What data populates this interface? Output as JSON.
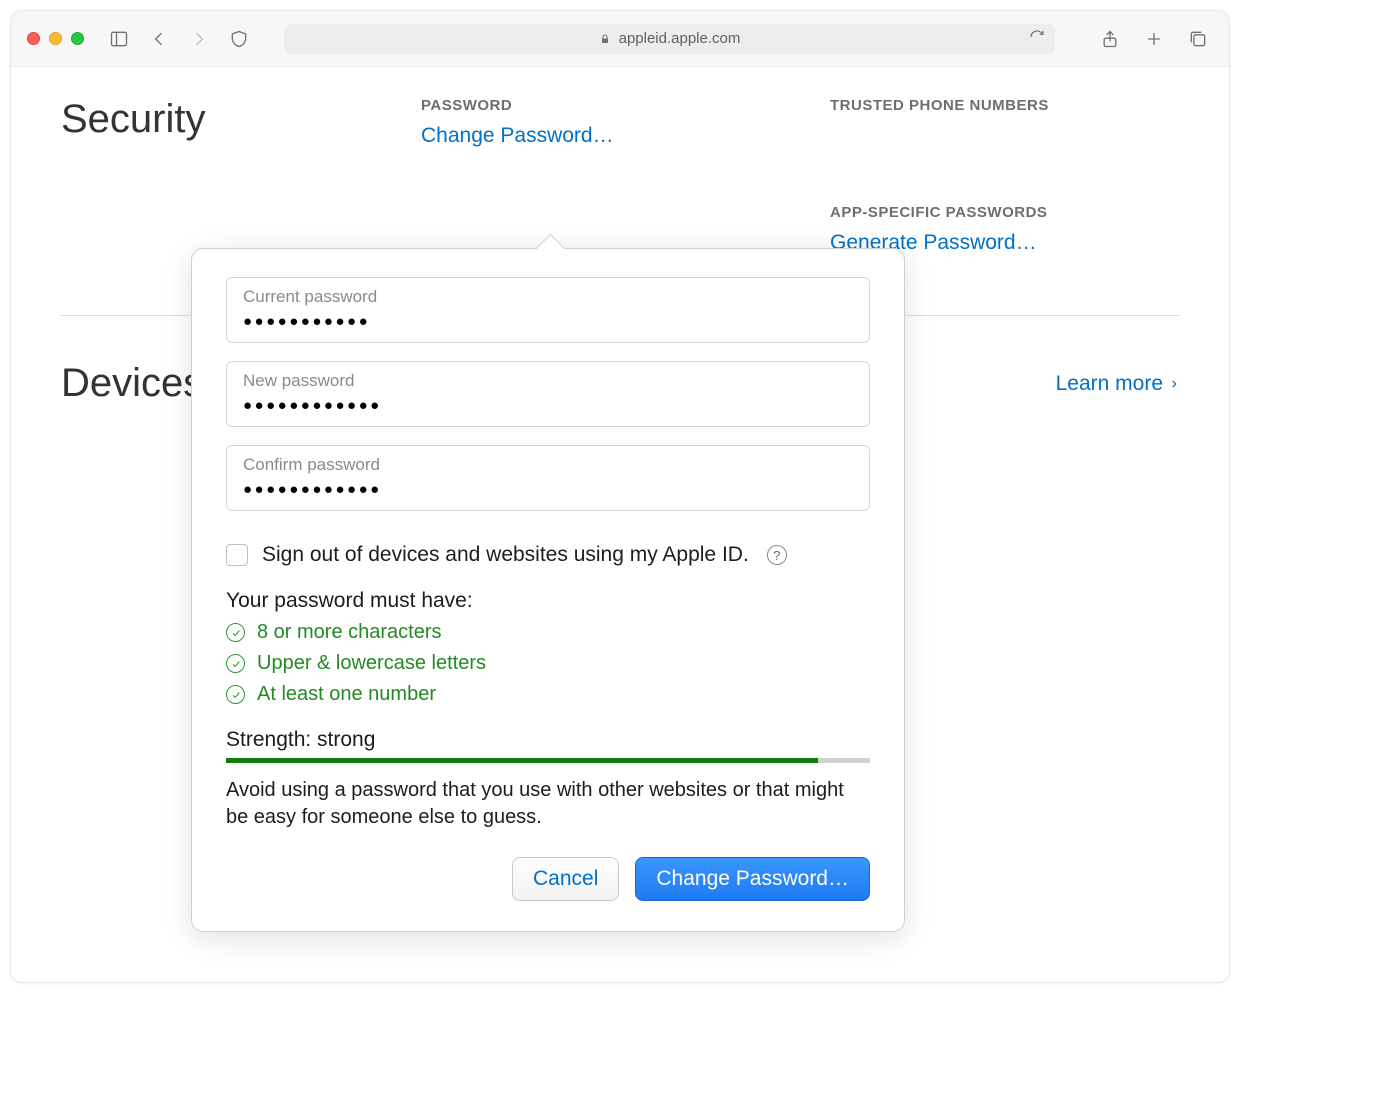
{
  "browser": {
    "url_display": "appleid.apple.com"
  },
  "page": {
    "security_title": "Security",
    "devices_title": "Devices",
    "password_header": "PASSWORD",
    "change_password_link": "Change Password…",
    "trusted_header": "TRUSTED PHONE NUMBERS",
    "app_specific_header": "APP-SPECIFIC PASSWORDS",
    "generate_password_link": "Generate Password…",
    "learn_more": "Learn more"
  },
  "popover": {
    "current_label": "Current password",
    "current_value": "●●●●●●●●●●●",
    "new_label": "New password",
    "new_value": "●●●●●●●●●●●●",
    "confirm_label": "Confirm password",
    "confirm_value": "●●●●●●●●●●●●",
    "signout_label": "Sign out of devices and websites using my Apple ID.",
    "req_title": "Your password must have:",
    "reqs": [
      "8 or more characters",
      "Upper & lowercase letters",
      "At least one number"
    ],
    "strength_label": "Strength: strong",
    "strength_percent": 92,
    "advice": "Avoid using a password that you use with other websites or that might be easy for someone else to guess.",
    "cancel": "Cancel",
    "submit": "Change Password…"
  }
}
